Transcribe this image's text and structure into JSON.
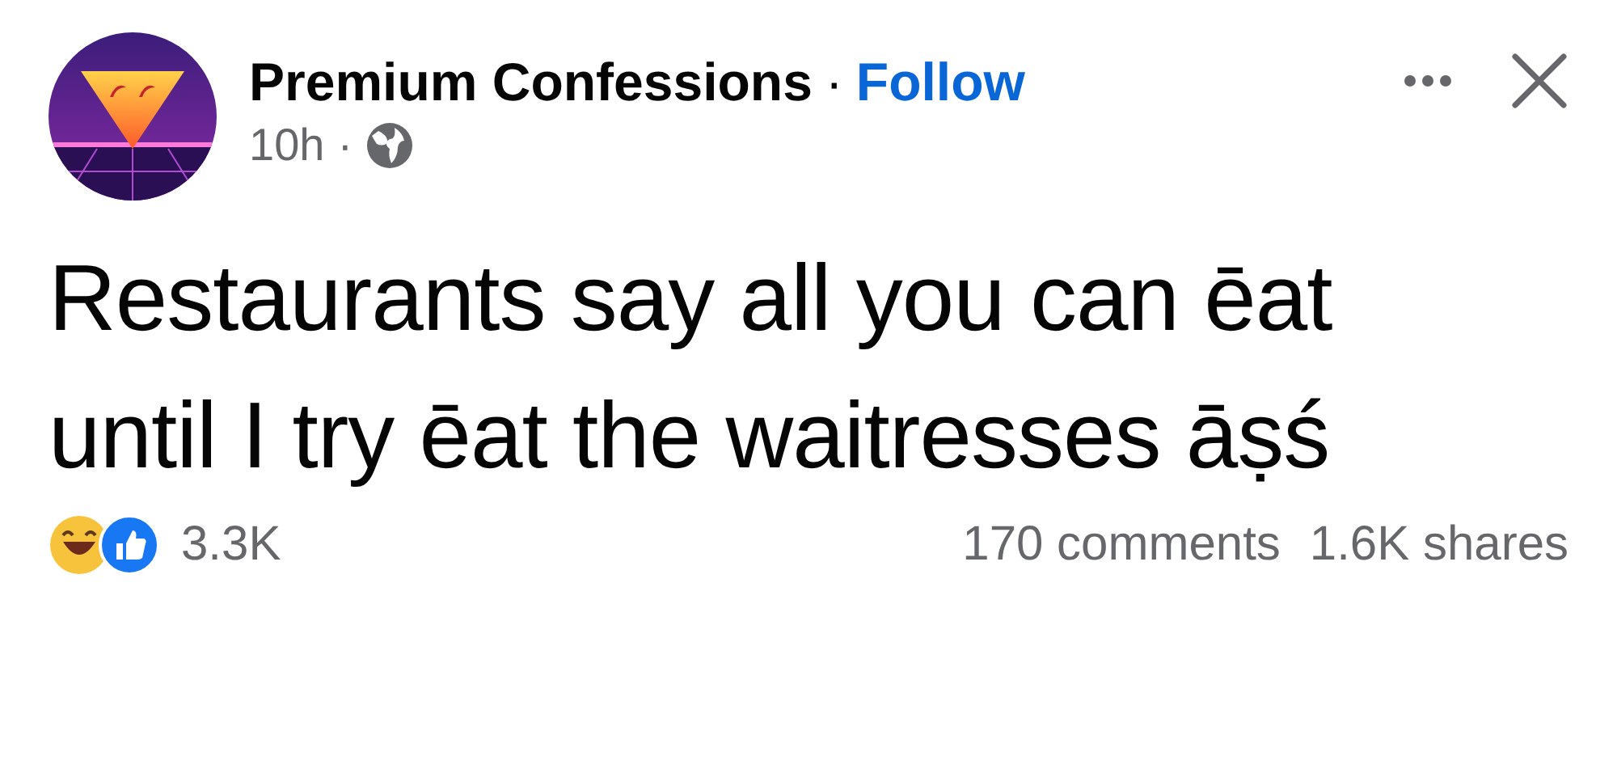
{
  "post": {
    "author": "Premium Confessions",
    "separator": "·",
    "follow": "Follow",
    "time": "10h",
    "time_separator": "·",
    "text": "Restaurants say all you can ēat until I try ēat the waitresses āṣś",
    "reactions_count": "3.3K",
    "comments": "170 comments",
    "shares": "1.6K shares"
  }
}
